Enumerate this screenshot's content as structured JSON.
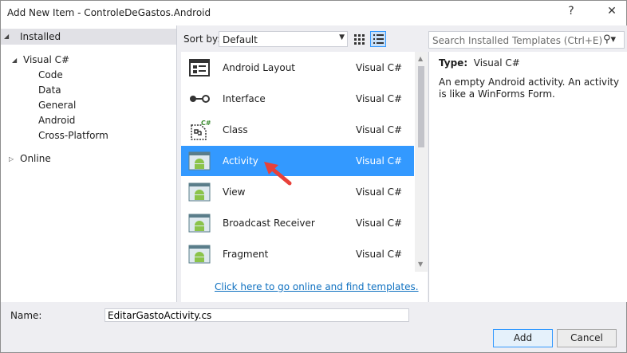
{
  "window": {
    "title": "Add New Item - ControleDeGastos.Android",
    "help_label": "?",
    "close_label": "✕"
  },
  "tree": {
    "installed": "Installed",
    "visual_csharp": "Visual C#",
    "children": [
      "Code",
      "Data",
      "General",
      "Android",
      "Cross-Platform"
    ],
    "online": "Online"
  },
  "toolbar": {
    "sort_by_label": "Sort by:",
    "sort_value": "Default",
    "search_placeholder": "Search Installed Templates (Ctrl+E)"
  },
  "templates": [
    {
      "name": "Android Layout",
      "lang": "Visual C#",
      "icon": "android-layout-icon"
    },
    {
      "name": "Interface",
      "lang": "Visual C#",
      "icon": "interface-icon"
    },
    {
      "name": "Class",
      "lang": "Visual C#",
      "icon": "class-icon"
    },
    {
      "name": "Activity",
      "lang": "Visual C#",
      "icon": "android-activity-icon",
      "selected": true
    },
    {
      "name": "View",
      "lang": "Visual C#",
      "icon": "android-view-icon"
    },
    {
      "name": "Broadcast Receiver",
      "lang": "Visual C#",
      "icon": "android-receiver-icon"
    },
    {
      "name": "Fragment",
      "lang": "Visual C#",
      "icon": "android-fragment-icon"
    }
  ],
  "online_link": "Click here to go online and find templates.",
  "details": {
    "type_label": "Type:",
    "type_value": "Visual C#",
    "description": "An empty Android activity.  An activity is like a WinForms Form."
  },
  "footer": {
    "name_label": "Name:",
    "name_value": "EditarGastoActivity.cs",
    "add_label": "Add",
    "cancel_label": "Cancel"
  },
  "colors": {
    "selection": "#3399ff",
    "link": "#0e70c0",
    "annotation_arrow": "#e8413a"
  }
}
